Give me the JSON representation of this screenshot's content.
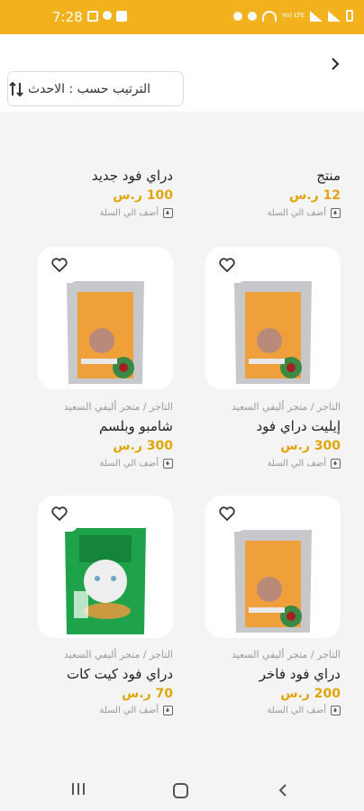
{
  "status_bar": {
    "time": "7:28",
    "left_icons": [
      "image-icon",
      "fire-icon",
      "facebook-icon"
    ],
    "right_icons": [
      "mute-icon",
      "location-icon",
      "wifi-icon",
      "lte-icon",
      "signal-icon",
      "signal-icon",
      "battery-icon"
    ],
    "network_text": "Vo) LTE"
  },
  "header": {
    "back_icon": "chevron-right-icon",
    "sort_label": "الترتيب حسب : الاحدث",
    "sort_icon": "sort-arrows-icon"
  },
  "top_row": [
    {
      "name": "دراي فود جديد",
      "price": "100 ر.س",
      "add_label": "أضف الي السلة"
    },
    {
      "name": "منتج",
      "price": "12 ر.س",
      "add_label": "أضف الي السلة"
    }
  ],
  "products": [
    {
      "merchant": "التاجر / متجر أليفي السعيد",
      "name": "إيليت دراي فود",
      "price": "300 ر.س",
      "add_label": "أضف الي السلة",
      "image": "orange-cat-food-bag"
    },
    {
      "merchant": "التاجر / متجر أليفي السعيد",
      "name": "شامبو وبلسم",
      "price": "300 ر.س",
      "add_label": "أضف الي السلة",
      "image": "orange-cat-food-bag"
    },
    {
      "merchant": "التاجر / متجر أليفي السعيد",
      "name": "دراي فود فاخر",
      "price": "200 ر.س",
      "add_label": "أضف الي السلة",
      "image": "orange-cat-food-bag"
    },
    {
      "merchant": "التاجر / متجر أليفي السعيد",
      "name": "دراي فود كيت كات",
      "price": "70 ر.س",
      "add_label": "أضف الي السلة",
      "image": "green-kitcat-food-bag"
    }
  ],
  "colors": {
    "accent": "#f2b21d",
    "price": "#e1a50c",
    "background": "#f4f4f4"
  },
  "nav": {
    "icons": [
      "recent-apps-icon",
      "home-icon",
      "back-icon"
    ]
  }
}
